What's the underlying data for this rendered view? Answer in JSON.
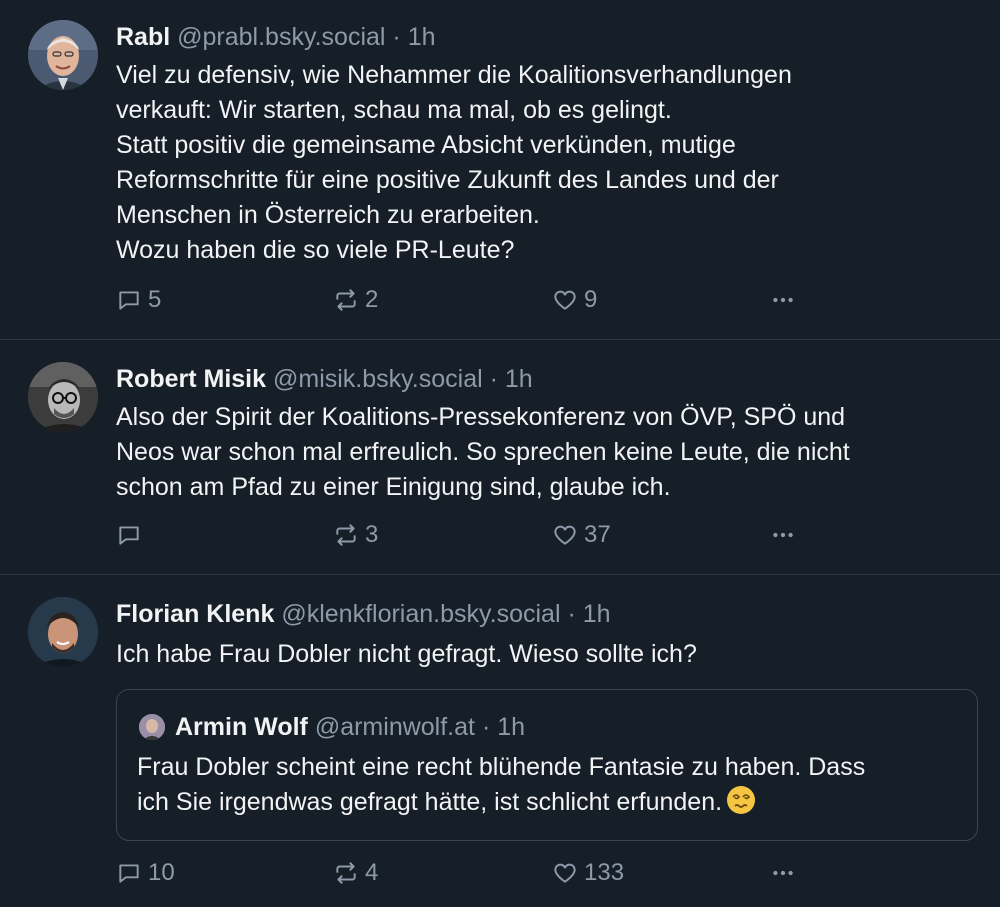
{
  "posts": [
    {
      "name": "Rabl",
      "handle": "@prabl.bsky.social",
      "separator": "·",
      "time": "1h",
      "text": "Viel zu defensiv, wie Nehammer die Koalitionsverhandlungen\nverkauft: Wir starten, schau ma mal, ob es gelingt.\nStatt positiv die gemeinsame Absicht verkünden, mutige\nReformschritte für eine positive Zukunft des Landes und der\nMenschen in Österreich zu erarbeiten.\nWozu haben die so viele PR-Leute?",
      "replies": "5",
      "reposts": "2",
      "likes": "9"
    },
    {
      "name": "Robert Misik",
      "handle": "@misik.bsky.social",
      "separator": "·",
      "time": "1h",
      "text": "Also der Spirit der Koalitions-Pressekonferenz von ÖVP, SPÖ und\nNeos war schon mal erfreulich. So sprechen keine Leute, die nicht\nschon am Pfad zu einer Einigung sind, glaube ich.",
      "replies": "",
      "reposts": "3",
      "likes": "37"
    },
    {
      "name": "Florian Klenk",
      "handle": "@klenkflorian.bsky.social",
      "separator": "·",
      "time": "1h",
      "text": "Ich habe Frau Dobler nicht gefragt. Wieso sollte ich?",
      "quote": {
        "name": "Armin Wolf",
        "handle": "@arminwolf.at",
        "separator": "·",
        "time": "1h",
        "text": "Frau Dobler scheint eine recht blühende Fantasie zu haben. Dass\nich Sie irgendwas gefragt hätte, ist schlicht erfunden.",
        "emoji": "dizzy-face-emoji"
      },
      "replies": "10",
      "reposts": "4",
      "likes": "133"
    }
  ],
  "icons": {
    "reply": "speech-bubble-icon",
    "repost": "repost-arrows-icon",
    "like": "heart-icon",
    "more": "ellipsis-icon"
  },
  "colors": {
    "background": "#161e27",
    "text": "#f1f3f5",
    "muted": "#8d9aa9",
    "divider": "#2e3945"
  }
}
